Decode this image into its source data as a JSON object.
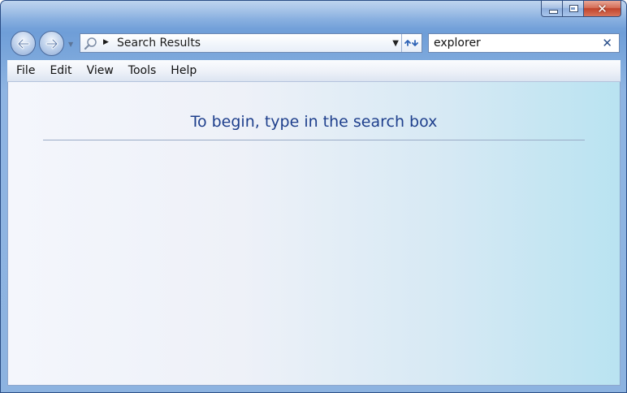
{
  "window": {
    "caption_buttons": [
      "minimize",
      "maximize",
      "close"
    ]
  },
  "navigation": {
    "back_icon": "arrow-left",
    "forward_icon": "arrow-right"
  },
  "address_bar": {
    "location": "Search Results",
    "icon": "magnifier"
  },
  "search": {
    "value": "explorer",
    "clear_glyph": "✕"
  },
  "menu": {
    "items": [
      "File",
      "Edit",
      "View",
      "Tools",
      "Help"
    ]
  },
  "content": {
    "hint": "To begin, type in the search box"
  },
  "colors": {
    "accent_text": "#1e3f8c",
    "close_button": "#c1442c",
    "frame": "#7aa6dc"
  }
}
